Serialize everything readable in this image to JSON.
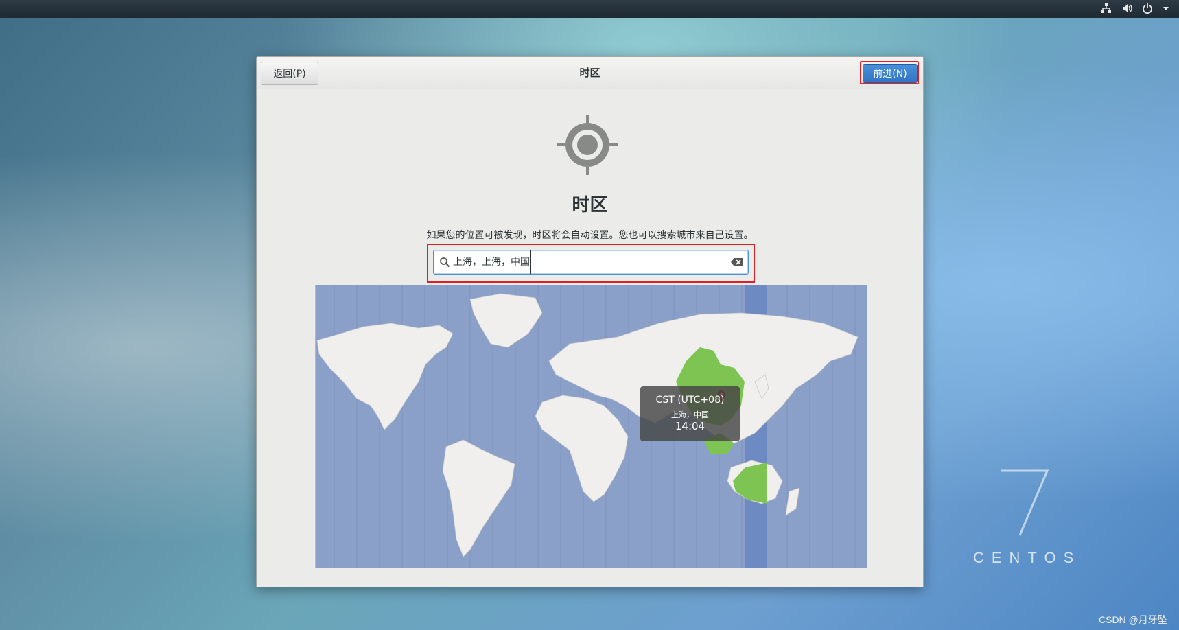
{
  "desktop": {
    "tray_icons": [
      "network-icon",
      "volume-icon",
      "power-icon",
      "menu-arrow-icon"
    ],
    "branding": "CENTOS",
    "branding_version": "7",
    "watermark": "CSDN @月牙坠"
  },
  "header": {
    "back_label": "返回(P)",
    "title": "时区",
    "next_label": "前进(N)"
  },
  "page": {
    "icon": "location-target-icon",
    "title": "时区",
    "description": "如果您的位置可被发现，时区将会自动设置。您也可以搜索城市来自己设置。"
  },
  "search": {
    "value": "上海，上海，中国",
    "icon": "search-icon",
    "clear_icon": "clear-text-icon"
  },
  "map": {
    "selected_timezone": "CST (UTC+08)",
    "selected_city": "上海，中国",
    "local_time": "14:04",
    "colors": {
      "ocean": "#8aa0c8",
      "land": "#f0efee",
      "highlight": "#7ec452",
      "band": "#6d8bc2",
      "marker": "#e02020"
    }
  }
}
